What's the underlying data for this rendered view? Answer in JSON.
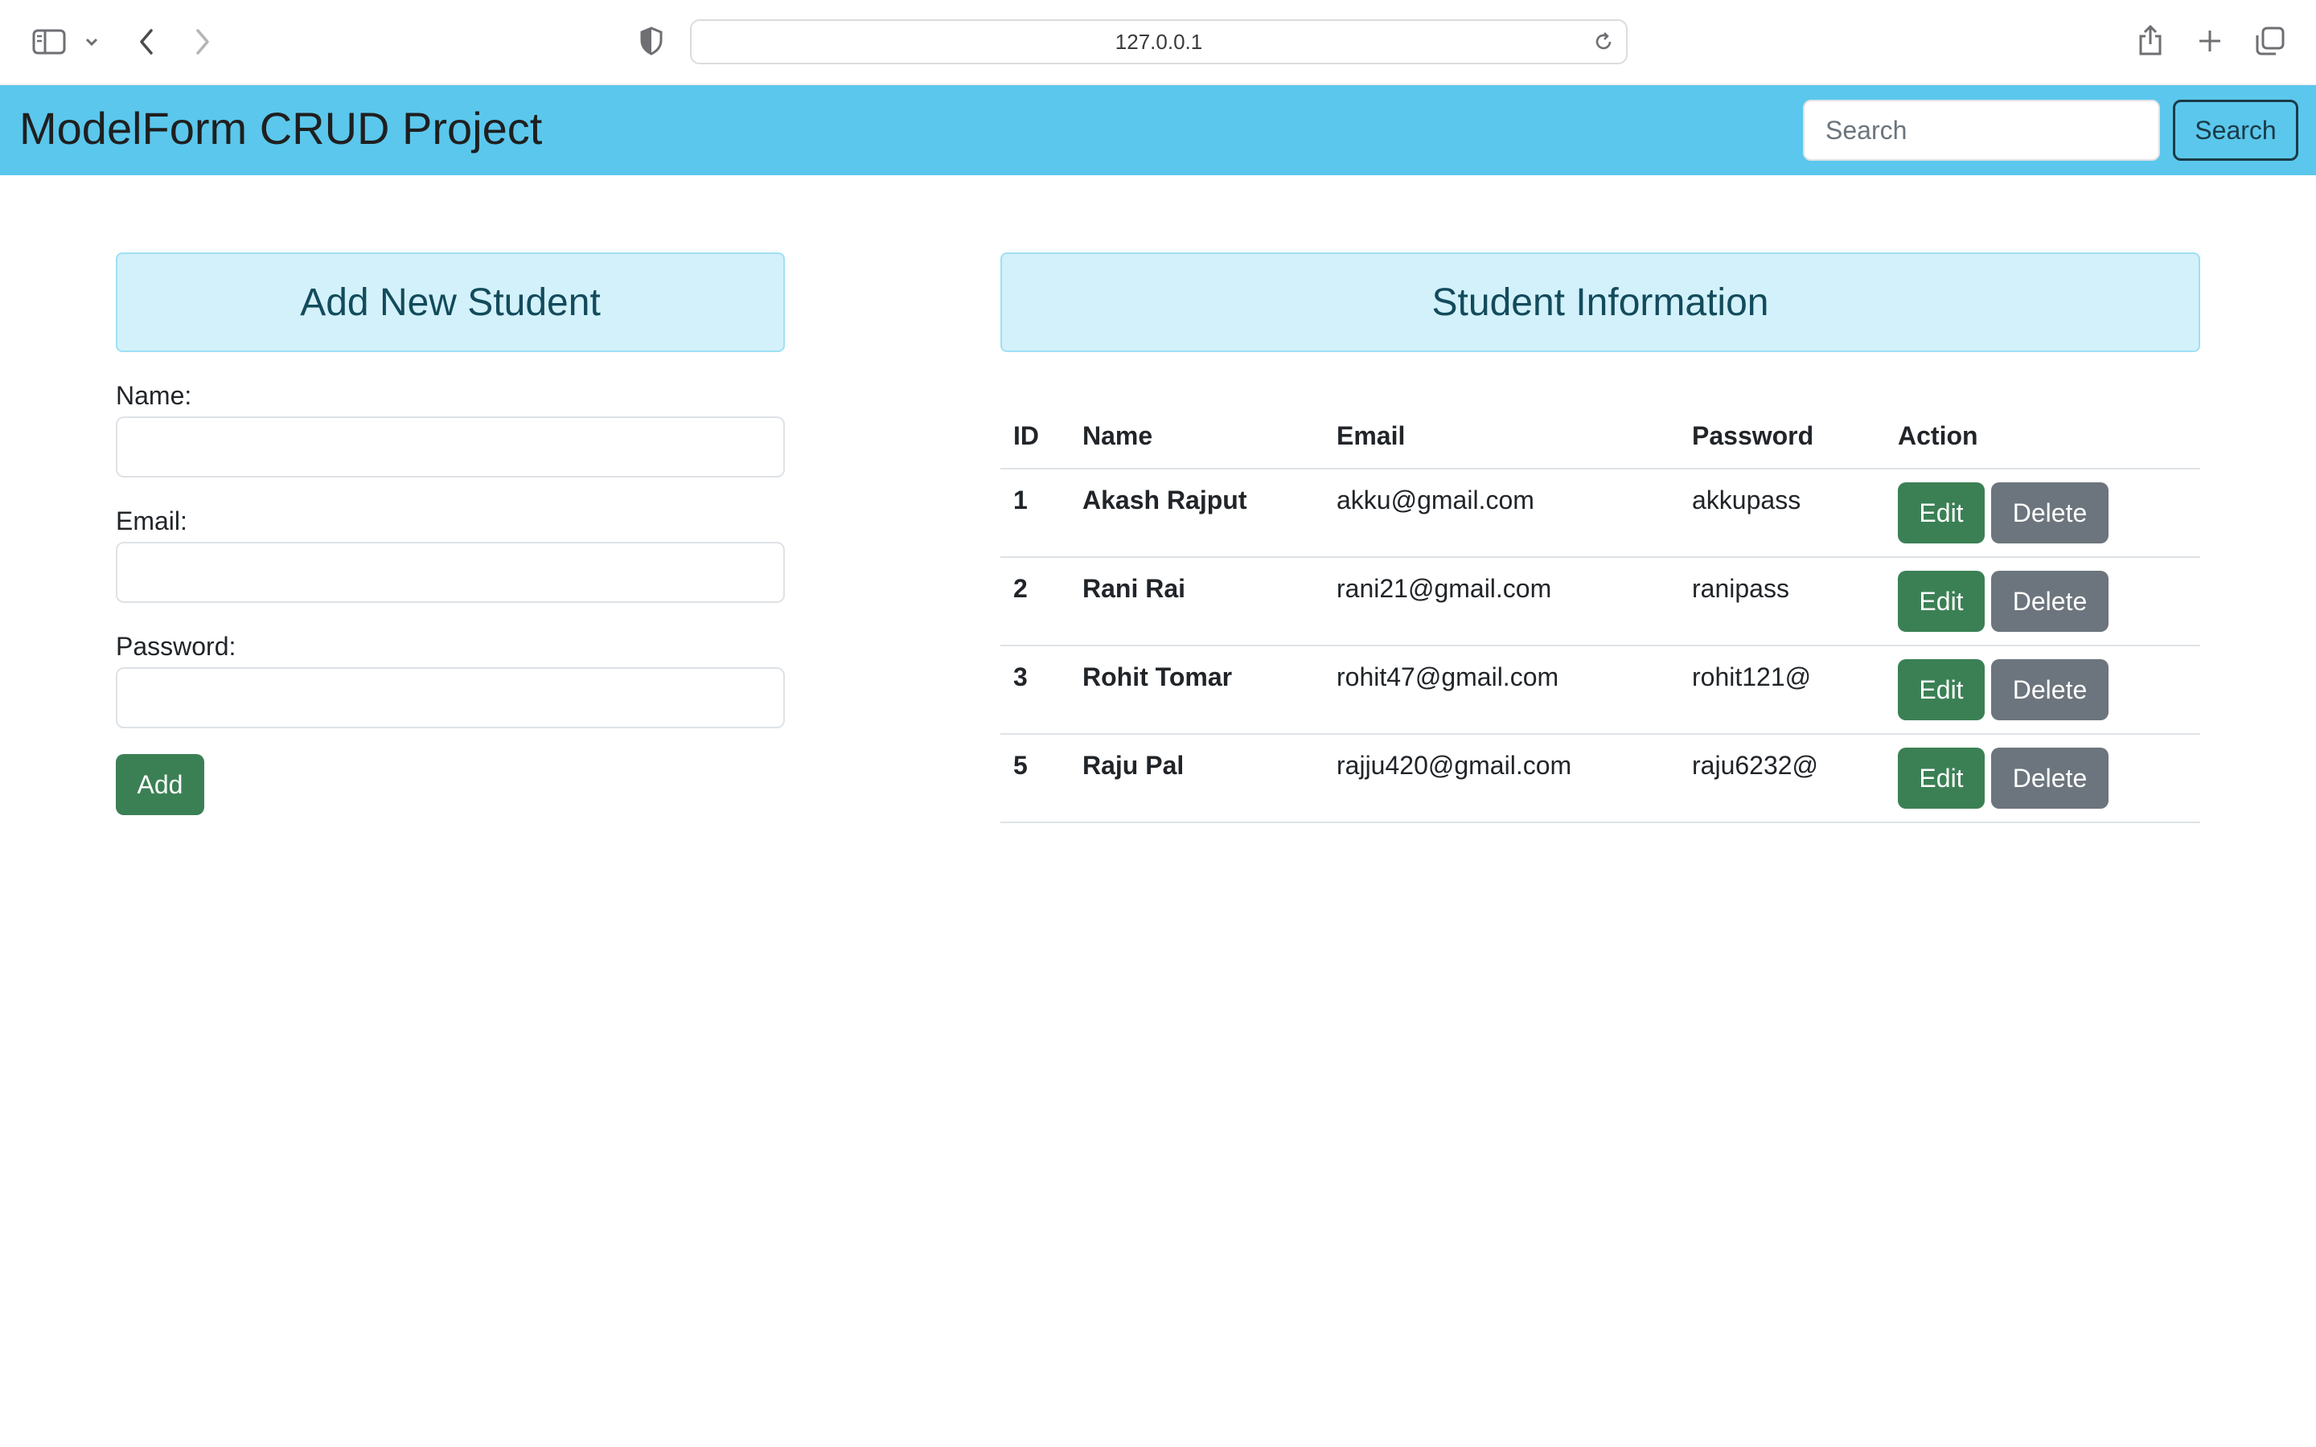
{
  "browser": {
    "url": "127.0.0.1",
    "icons": [
      "sidebar-icon",
      "chevron-down-icon",
      "back-arrow-icon",
      "forward-arrow-icon",
      "shield-icon",
      "reload-icon",
      "share-icon",
      "new-tab-icon",
      "tabs-overview-icon"
    ]
  },
  "navbar": {
    "brand": "ModelForm CRUD Project",
    "search_placeholder": "Search",
    "search_button": "Search",
    "background_color": "#5bc7ec"
  },
  "add_form": {
    "heading": "Add New Student",
    "name_label": "Name:",
    "email_label": "Email:",
    "password_label": "Password:",
    "name_value": "",
    "email_value": "",
    "password_value": "",
    "submit_label": "Add"
  },
  "student_table": {
    "heading": "Student Information",
    "columns": [
      "ID",
      "Name",
      "Email",
      "Password",
      "Action"
    ],
    "edit_label": "Edit",
    "delete_label": "Delete",
    "rows": [
      {
        "id": "1",
        "name": "Akash Rajput",
        "email": "akku@gmail.com",
        "password": "akkupass"
      },
      {
        "id": "2",
        "name": "Rani Rai",
        "email": "rani21@gmail.com",
        "password": "ranipass"
      },
      {
        "id": "3",
        "name": "Rohit Tomar",
        "email": "rohit47@gmail.com",
        "password": "rohit121@"
      },
      {
        "id": "5",
        "name": "Raju Pal",
        "email": "rajju420@gmail.com",
        "password": "raju6232@"
      }
    ]
  },
  "colors": {
    "success": "#3b8055",
    "secondary": "#6c757d",
    "info_light": "#d3f1fa"
  }
}
